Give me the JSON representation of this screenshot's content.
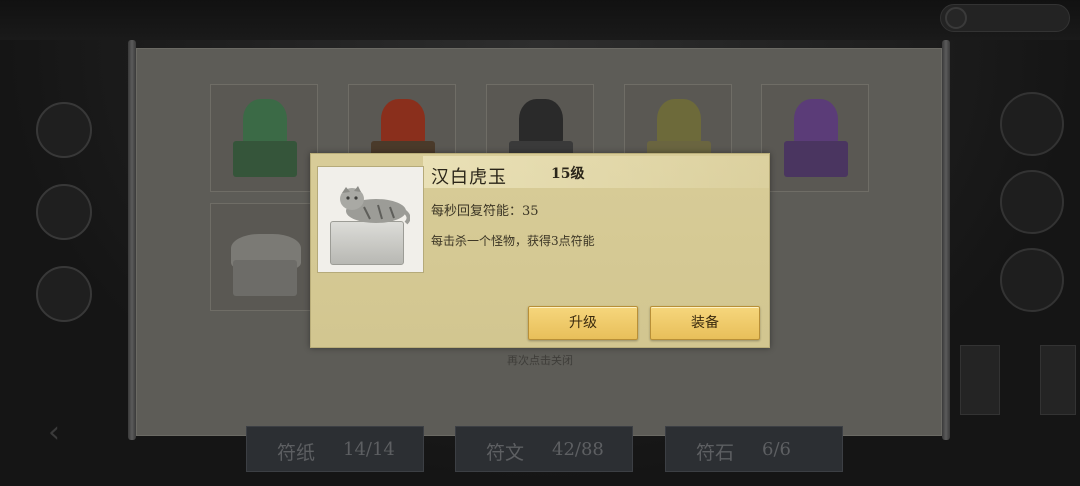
{
  "top": {
    "title": "",
    "currency_value": ""
  },
  "side_nav": [
    {
      "label": ""
    },
    {
      "label": ""
    },
    {
      "label": ""
    }
  ],
  "grid": {
    "items": [
      {
        "name": "jade-qilin",
        "color_figure": "#3b6a46",
        "color_base": "#35553a"
      },
      {
        "name": "red-phoenix",
        "color_figure": "#8a2f1c",
        "color_base": "#4a3a2a"
      },
      {
        "name": "black-rabbit",
        "color_figure": "#2a2a2a",
        "color_base": "#3a3a3a"
      },
      {
        "name": "gold-turtle",
        "color_figure": "#6d6a3a",
        "color_base": "#6a6540"
      },
      {
        "name": "purple-fox",
        "color_figure": "#5b3c78",
        "color_base": "#4a3560"
      },
      {
        "name": "white-tiger",
        "color_figure": "#7b7a75",
        "color_base": "#6d6c68"
      }
    ],
    "hint": "再次点击关闭"
  },
  "tabs": [
    {
      "label": "符纸",
      "count": "14/14"
    },
    {
      "label": "符文",
      "count": "42/88"
    },
    {
      "label": "符石",
      "count": "6/6"
    }
  ],
  "dialog": {
    "name": "汉白虎玉",
    "level": "15级",
    "regen": "每秒回复符能：35",
    "description": "每击杀一个怪物，获得3点符能",
    "upgrade_label": "升级",
    "equip_label": "装备"
  }
}
